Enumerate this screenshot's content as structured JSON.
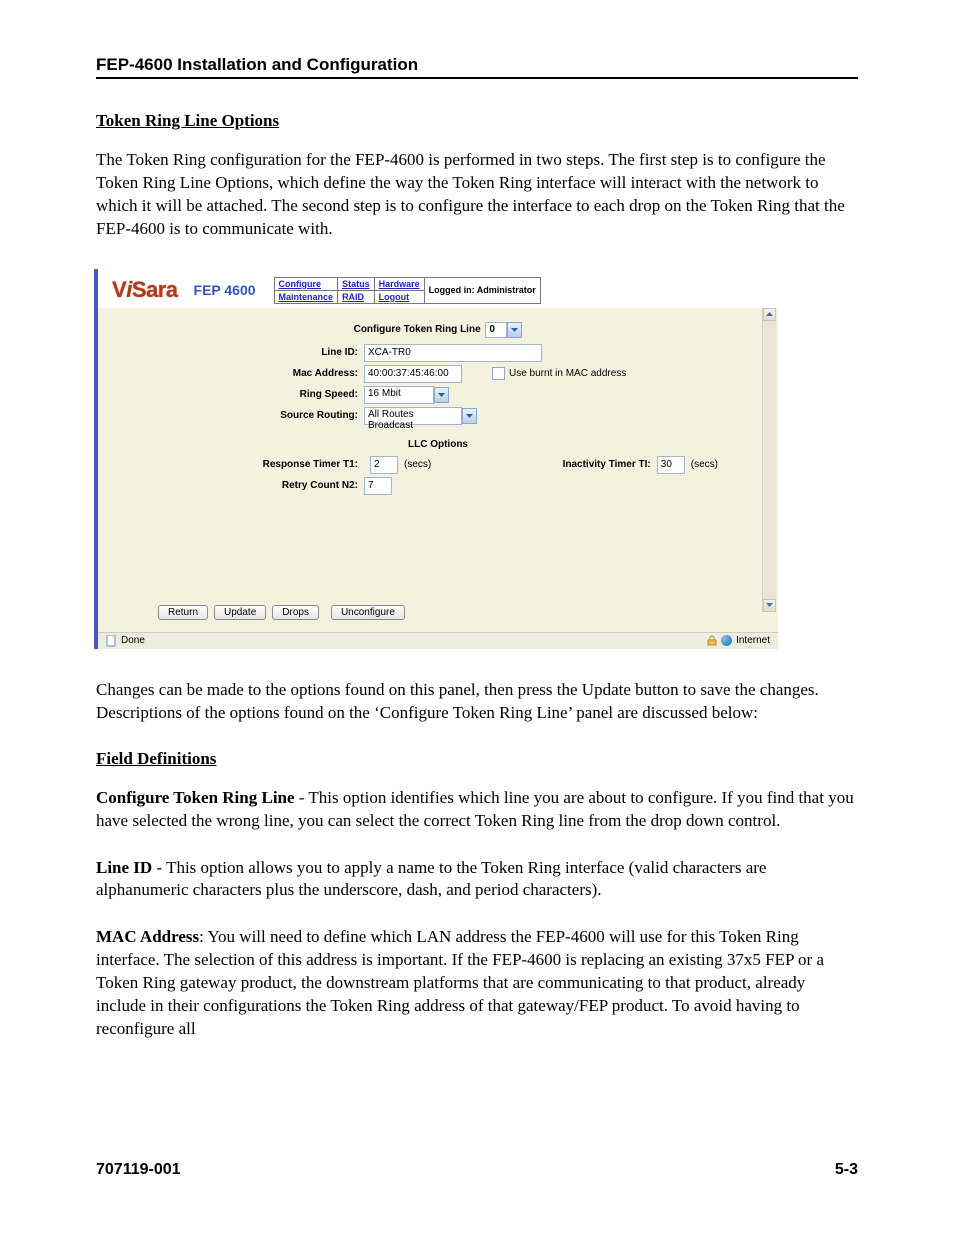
{
  "doc": {
    "header": "FEP-4600 Installation and Configuration",
    "section_h": "Token Ring Line Options",
    "intro": "The Token Ring configuration for the FEP-4600 is performed in two steps. The first step is to configure the Token Ring Line Options, which define the way the Token Ring interface will interact with the network to which it will be attached. The second step is to configure the interface to each drop on the Token Ring that the FEP-4600 is to communicate with.",
    "after_screenshot": "Changes can be made to the options found on this panel, then press the Update button to save the changes. Descriptions of the options found on the ‘Configure Token Ring Line’ panel are discussed below:",
    "field_defs_h": "Field Definitions",
    "fd1_b": "Configure Token Ring Line",
    "fd1": " - This option identifies which line you are about to configure. If you find that you have selected the wrong line, you can select the correct Token Ring line from the drop down control.",
    "fd2_b": "Line ID",
    "fd2": " - This option allows you to apply a name to the Token Ring interface (valid characters are alphanumeric characters plus the underscore, dash, and period characters).",
    "fd3_b": "MAC Address",
    "fd3": ":  You will need to define which LAN address the FEP-4600 will use for this Token Ring interface. The selection of this address is important. If the FEP-4600 is replacing an existing 37x5 FEP or a Token Ring gateway product, the downstream platforms that are communicating to that product, already include in their configurations the Token Ring address of that gateway/FEP product. To avoid having to reconfigure all",
    "footer_left": "707119-001",
    "footer_right": "5-3"
  },
  "ss": {
    "logo_fep": "FEP 4600",
    "nav": {
      "configure": "Configure",
      "status": "Status",
      "hardware": "Hardware",
      "maintenance": "Maintenance",
      "raid": "RAID",
      "logout": "Logout",
      "loggedin": "Logged in: Administrator"
    },
    "title": "Configure Token Ring Line",
    "line_select": "0",
    "line_id_l": "Line ID:",
    "line_id_v": "XCA-TR0",
    "mac_l": "Mac Address:",
    "mac_v": "40:00:37:45:46:00",
    "burnt_l": "Use burnt in MAC address",
    "speed_l": "Ring Speed:",
    "speed_v": "16 Mbit",
    "routing_l": "Source Routing:",
    "routing_v": "All Routes Broadcast",
    "llc_h": "LLC Options",
    "t1_l": "Response Timer T1:",
    "t1_v": "2",
    "secs": "(secs)",
    "ti_l": "Inactivity Timer TI:",
    "ti_v": "30",
    "n2_l": "Retry Count N2:",
    "n2_v": "7",
    "btn_return": "Return",
    "btn_update": "Update",
    "btn_drops": "Drops",
    "btn_unconfig": "Unconfigure",
    "status_done": "Done",
    "status_zone": "Internet"
  }
}
